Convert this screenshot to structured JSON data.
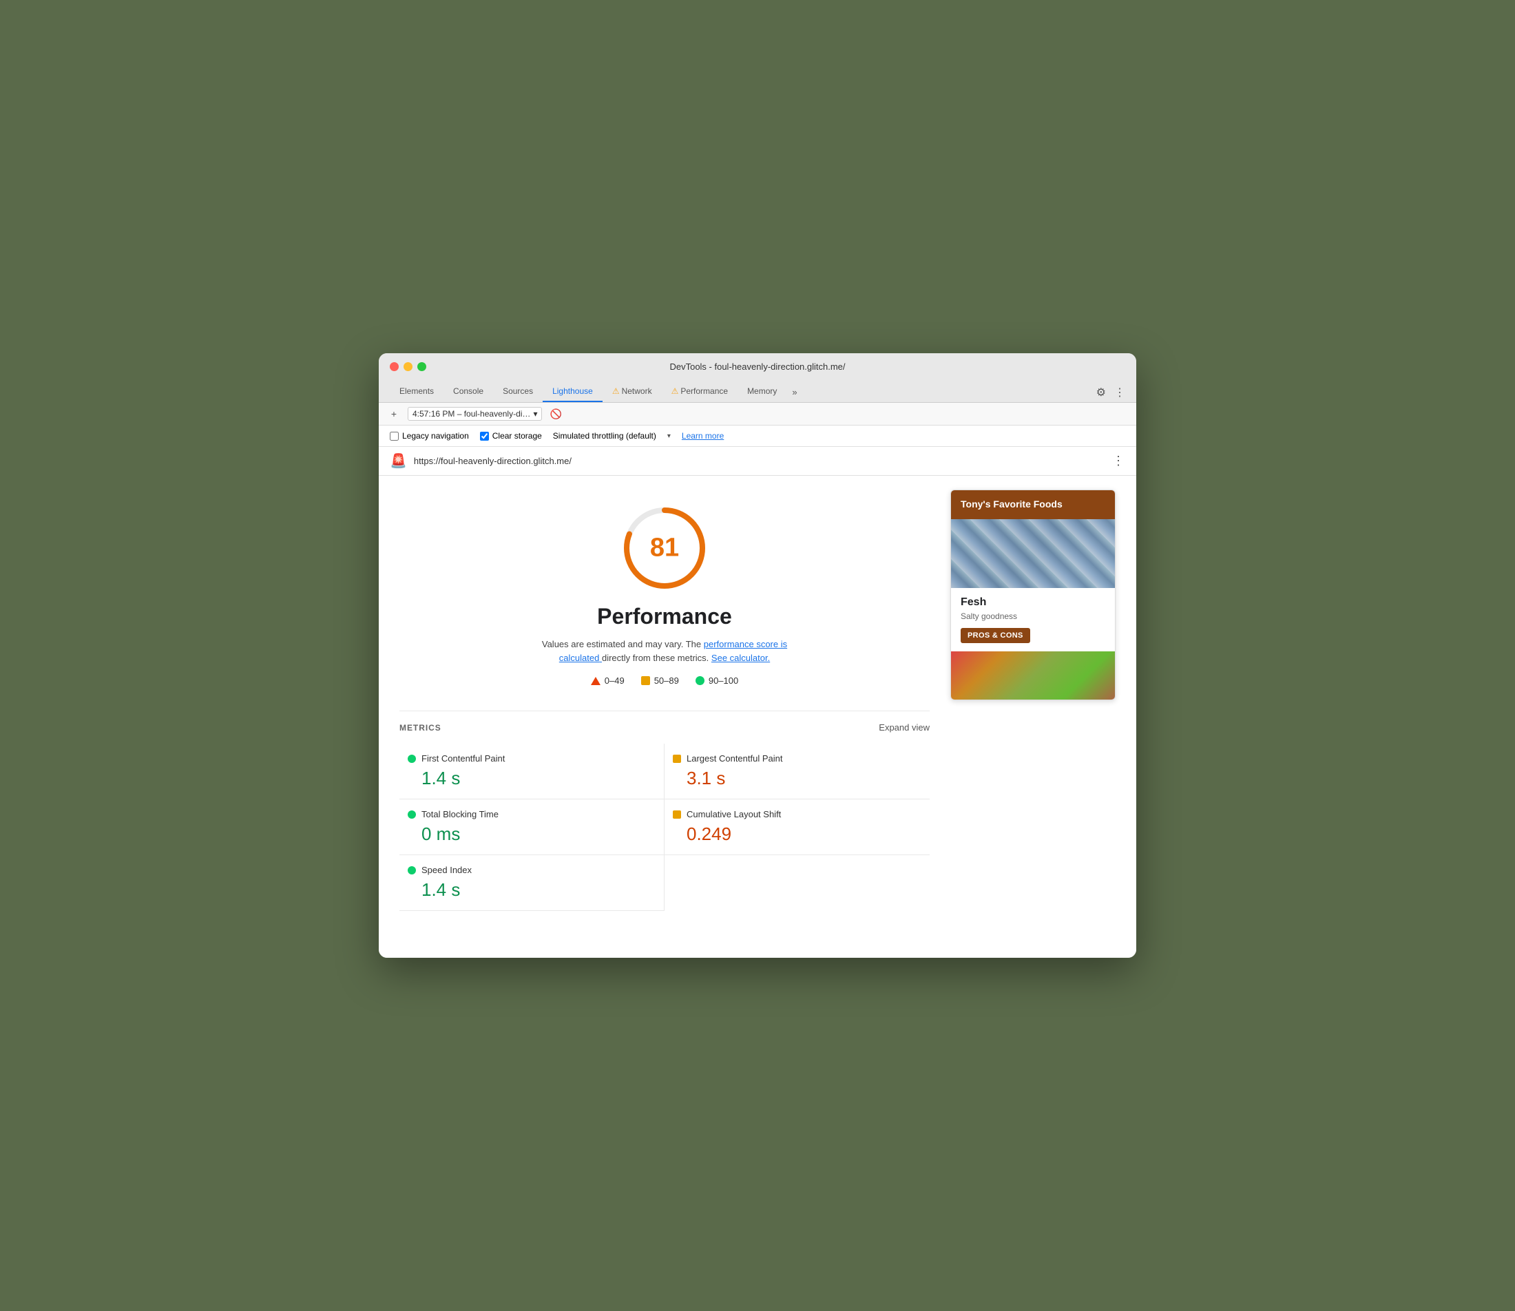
{
  "window": {
    "title": "DevTools - foul-heavenly-direction.glitch.me/"
  },
  "tabs": [
    {
      "id": "elements",
      "label": "Elements",
      "active": false,
      "warning": false
    },
    {
      "id": "console",
      "label": "Console",
      "active": false,
      "warning": false
    },
    {
      "id": "sources",
      "label": "Sources",
      "active": false,
      "warning": false
    },
    {
      "id": "lighthouse",
      "label": "Lighthouse",
      "active": true,
      "warning": false
    },
    {
      "id": "network",
      "label": "Network",
      "active": false,
      "warning": true
    },
    {
      "id": "performance",
      "label": "Performance",
      "active": false,
      "warning": true
    },
    {
      "id": "memory",
      "label": "Memory",
      "active": false,
      "warning": false
    }
  ],
  "toolbar": {
    "session": "4:57:16 PM – foul-heavenly-di…",
    "more_icon": "›› "
  },
  "options": {
    "legacy_navigation": {
      "label": "Legacy navigation",
      "checked": false
    },
    "clear_storage": {
      "label": "Clear storage",
      "checked": true
    },
    "throttling": "Simulated throttling (default)",
    "learn_more": "Learn more"
  },
  "url_bar": {
    "url": "https://foul-heavenly-direction.glitch.me/"
  },
  "score_section": {
    "score": "81",
    "title": "Performance",
    "description_plain": "Values are estimated and may vary. The",
    "link1": "performance score is calculated",
    "description_mid": "directly from these metrics.",
    "link2": "See calculator.",
    "gauge_percent": 81
  },
  "legend": {
    "items": [
      {
        "type": "triangle",
        "range": "0–49"
      },
      {
        "type": "square",
        "range": "50–89"
      },
      {
        "type": "circle",
        "range": "90–100"
      }
    ]
  },
  "metrics": {
    "header": "METRICS",
    "expand": "Expand view",
    "items": [
      {
        "id": "fcp",
        "name": "First Contentful Paint",
        "value": "1.4 s",
        "status": "green"
      },
      {
        "id": "lcp",
        "name": "Largest Contentful Paint",
        "value": "3.1 s",
        "status": "orange"
      },
      {
        "id": "tbt",
        "name": "Total Blocking Time",
        "value": "0 ms",
        "status": "green"
      },
      {
        "id": "cls",
        "name": "Cumulative Layout Shift",
        "value": "0.249",
        "status": "orange"
      },
      {
        "id": "si",
        "name": "Speed Index",
        "value": "1.4 s",
        "status": "green"
      }
    ]
  },
  "preview": {
    "header": "Tony's Favorite Foods",
    "food_name": "Fesh",
    "food_desc": "Salty goodness",
    "button_label": "PROS & CONS"
  }
}
